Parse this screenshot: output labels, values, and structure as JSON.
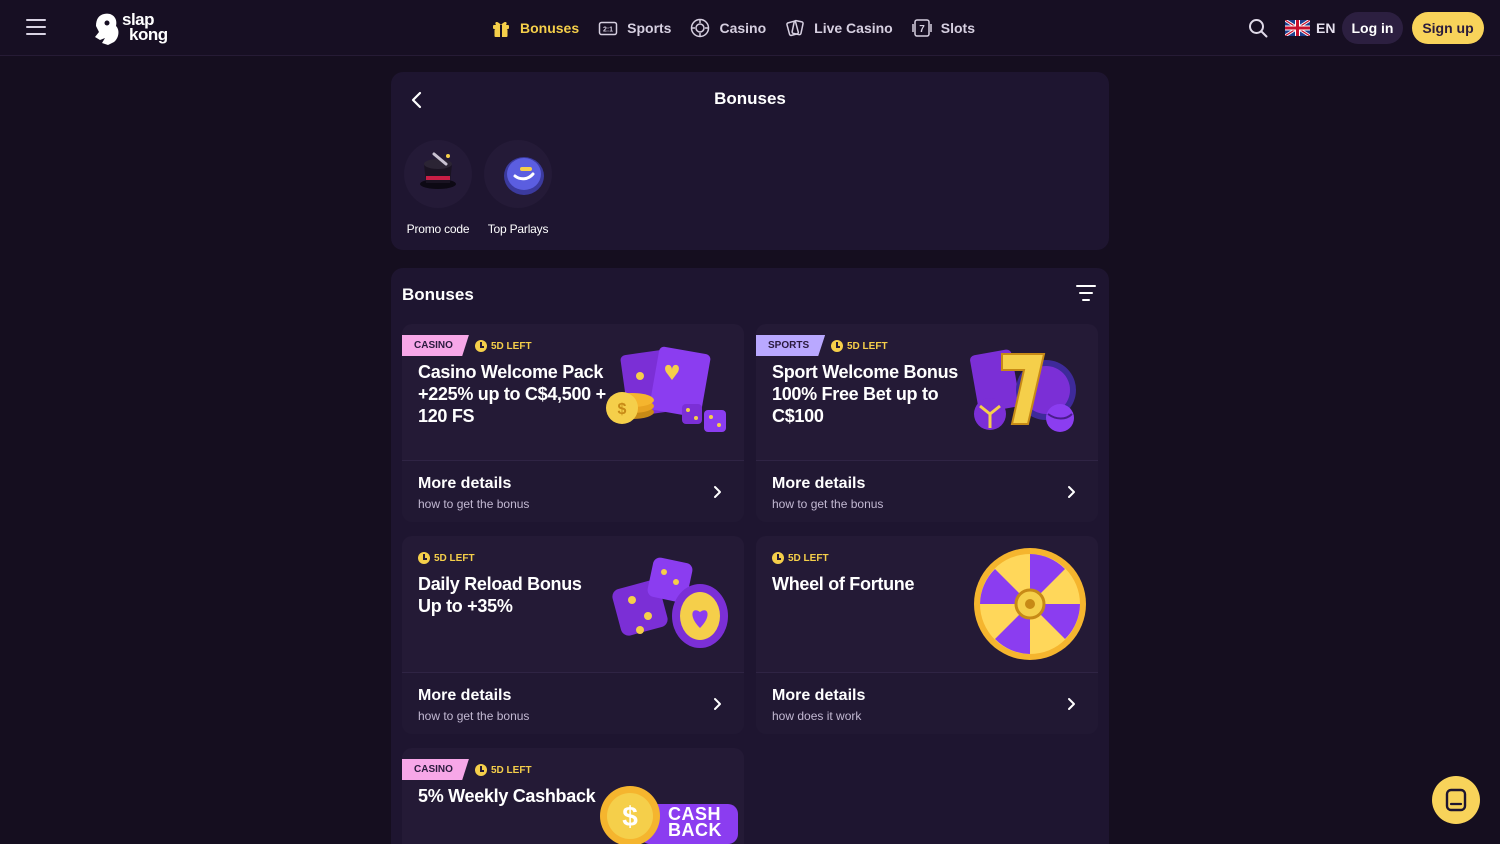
{
  "header": {
    "logo_line1": "slap",
    "logo_line2": "kong",
    "nav": [
      {
        "label": "Bonuses",
        "icon": "gift-icon",
        "active": true
      },
      {
        "label": "Sports",
        "icon": "odds-ticket-icon"
      },
      {
        "label": "Casino",
        "icon": "casino-chip-icon"
      },
      {
        "label": "Live Casino",
        "icon": "cards-icon"
      },
      {
        "label": "Slots",
        "icon": "slot-seven-icon"
      }
    ],
    "language": "EN",
    "login_label": "Log in",
    "signup_label": "Sign up"
  },
  "page": {
    "title": "Bonuses",
    "quick_links": [
      {
        "label": "Promo code",
        "icon": "magic-hat-icon"
      },
      {
        "label": "Top Parlays",
        "icon": "parlay-coin-icon"
      }
    ]
  },
  "bonuses": {
    "title": "Bonuses",
    "cards": [
      {
        "tag": "CASINO",
        "days_left": "5D LEFT",
        "title": "Casino Welcome Pack +225% up to C$4,500 + 120 FS",
        "more_title": "More details",
        "more_sub": "how to get the bonus"
      },
      {
        "tag": "SPORTS",
        "days_left": "5D LEFT",
        "title": "Sport Welcome Bonus 100% Free Bet up to C$100",
        "more_title": "More details",
        "more_sub": "how to get the bonus"
      },
      {
        "tag": "",
        "days_left": "5D LEFT",
        "title": "Daily Reload Bonus Up to +35%",
        "more_title": "More details",
        "more_sub": "how to get the bonus"
      },
      {
        "tag": "",
        "days_left": "5D LEFT",
        "title": "Wheel of Fortune",
        "more_title": "More details",
        "more_sub": "how does it work"
      },
      {
        "tag": "CASINO",
        "days_left": "5D LEFT",
        "title": "5% Weekly Cashback",
        "art_text_1": "CASH",
        "art_text_2": "BACK"
      }
    ]
  },
  "colors": {
    "accent": "#f5cf4a",
    "background": "#150e1f",
    "panel": "#1e1530",
    "casino_tag": "#f7a7e8",
    "sports_tag": "#b9a8ff"
  }
}
